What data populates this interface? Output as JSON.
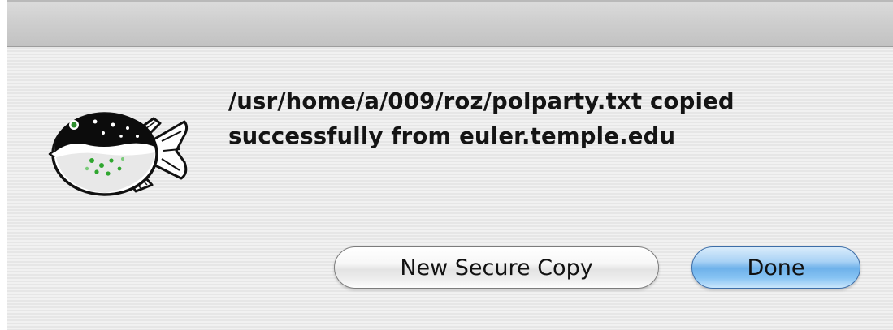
{
  "dialog": {
    "icon": "pufferfish-app-icon",
    "message_line1": "/usr/home/a/009/roz/polparty.txt copied",
    "message_line2": "successfully from euler.temple.edu"
  },
  "buttons": {
    "secondary_label": "New Secure Copy",
    "primary_label": "Done"
  },
  "colors": {
    "primary_button": "#7db9ef",
    "secondary_button": "#f2f2f2",
    "text": "#141414"
  }
}
